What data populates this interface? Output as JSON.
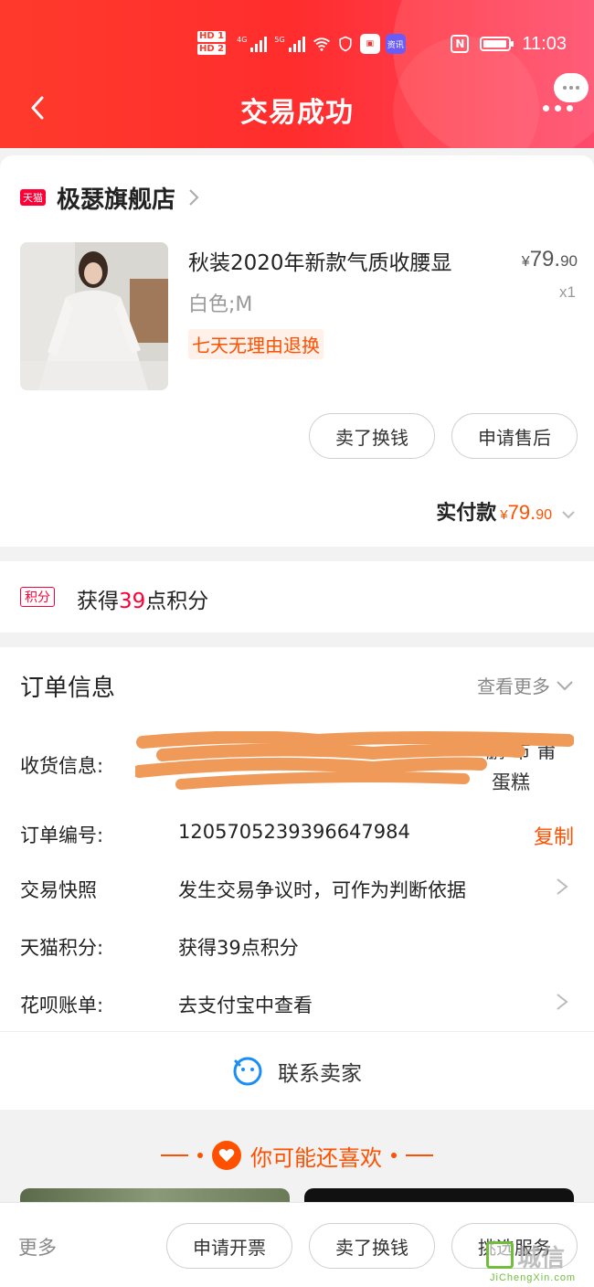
{
  "status_bar": {
    "hd1": "HD 1",
    "hd2": "HD 2",
    "net1": "4G",
    "net2": "5G",
    "app_label": "资讯",
    "time": "11:03"
  },
  "nav": {
    "title": "交易成功"
  },
  "shop": {
    "badge": "天猫",
    "name": "极瑟旗舰店"
  },
  "product": {
    "title": "秋装2020年新款气质收腰显",
    "price_symbol": "¥",
    "price_int": "79.",
    "price_dec": "90",
    "qty": "x1",
    "sku": "白色;M",
    "tag": "七天无理由退换",
    "actions": [
      "卖了换钱",
      "申请售后"
    ]
  },
  "payment": {
    "label": "实付款",
    "price_symbol": "¥",
    "price_int": "79.",
    "price_dec": "90"
  },
  "points": {
    "badge": "积分",
    "prefix": "获得",
    "number": "39",
    "suffix": "点积分"
  },
  "order_info": {
    "title": "订单信息",
    "see_more": "查看更多",
    "shipping_label": "收货信息:",
    "shipping_peek_1": "鹏 市 莆",
    "shipping_peek_2": "蛋糕",
    "order_no_label": "订单编号:",
    "order_no": "1205705239396647984",
    "copy": "复制",
    "snapshot_label": "交易快照",
    "snapshot_value": "发生交易争议时，可作为判断依据",
    "tmall_points_label": "天猫积分:",
    "tmall_points_value": "获得39点积分",
    "huabei_label": "花呗账单:",
    "huabei_value": "去支付宝中查看"
  },
  "contact": {
    "label": "联系卖家"
  },
  "recommend": {
    "title": "你可能还喜欢"
  },
  "bottom_bar": {
    "more": "更多",
    "buttons": [
      "申请开票",
      "卖了换钱",
      "挑选服务"
    ]
  },
  "watermark": {
    "cn": "城信",
    "en": "JiChengXin.com"
  },
  "colors": {
    "header_red": "#ff3a2c",
    "tmall_red": "#ff0036",
    "accent_orange": "#ff5000"
  }
}
